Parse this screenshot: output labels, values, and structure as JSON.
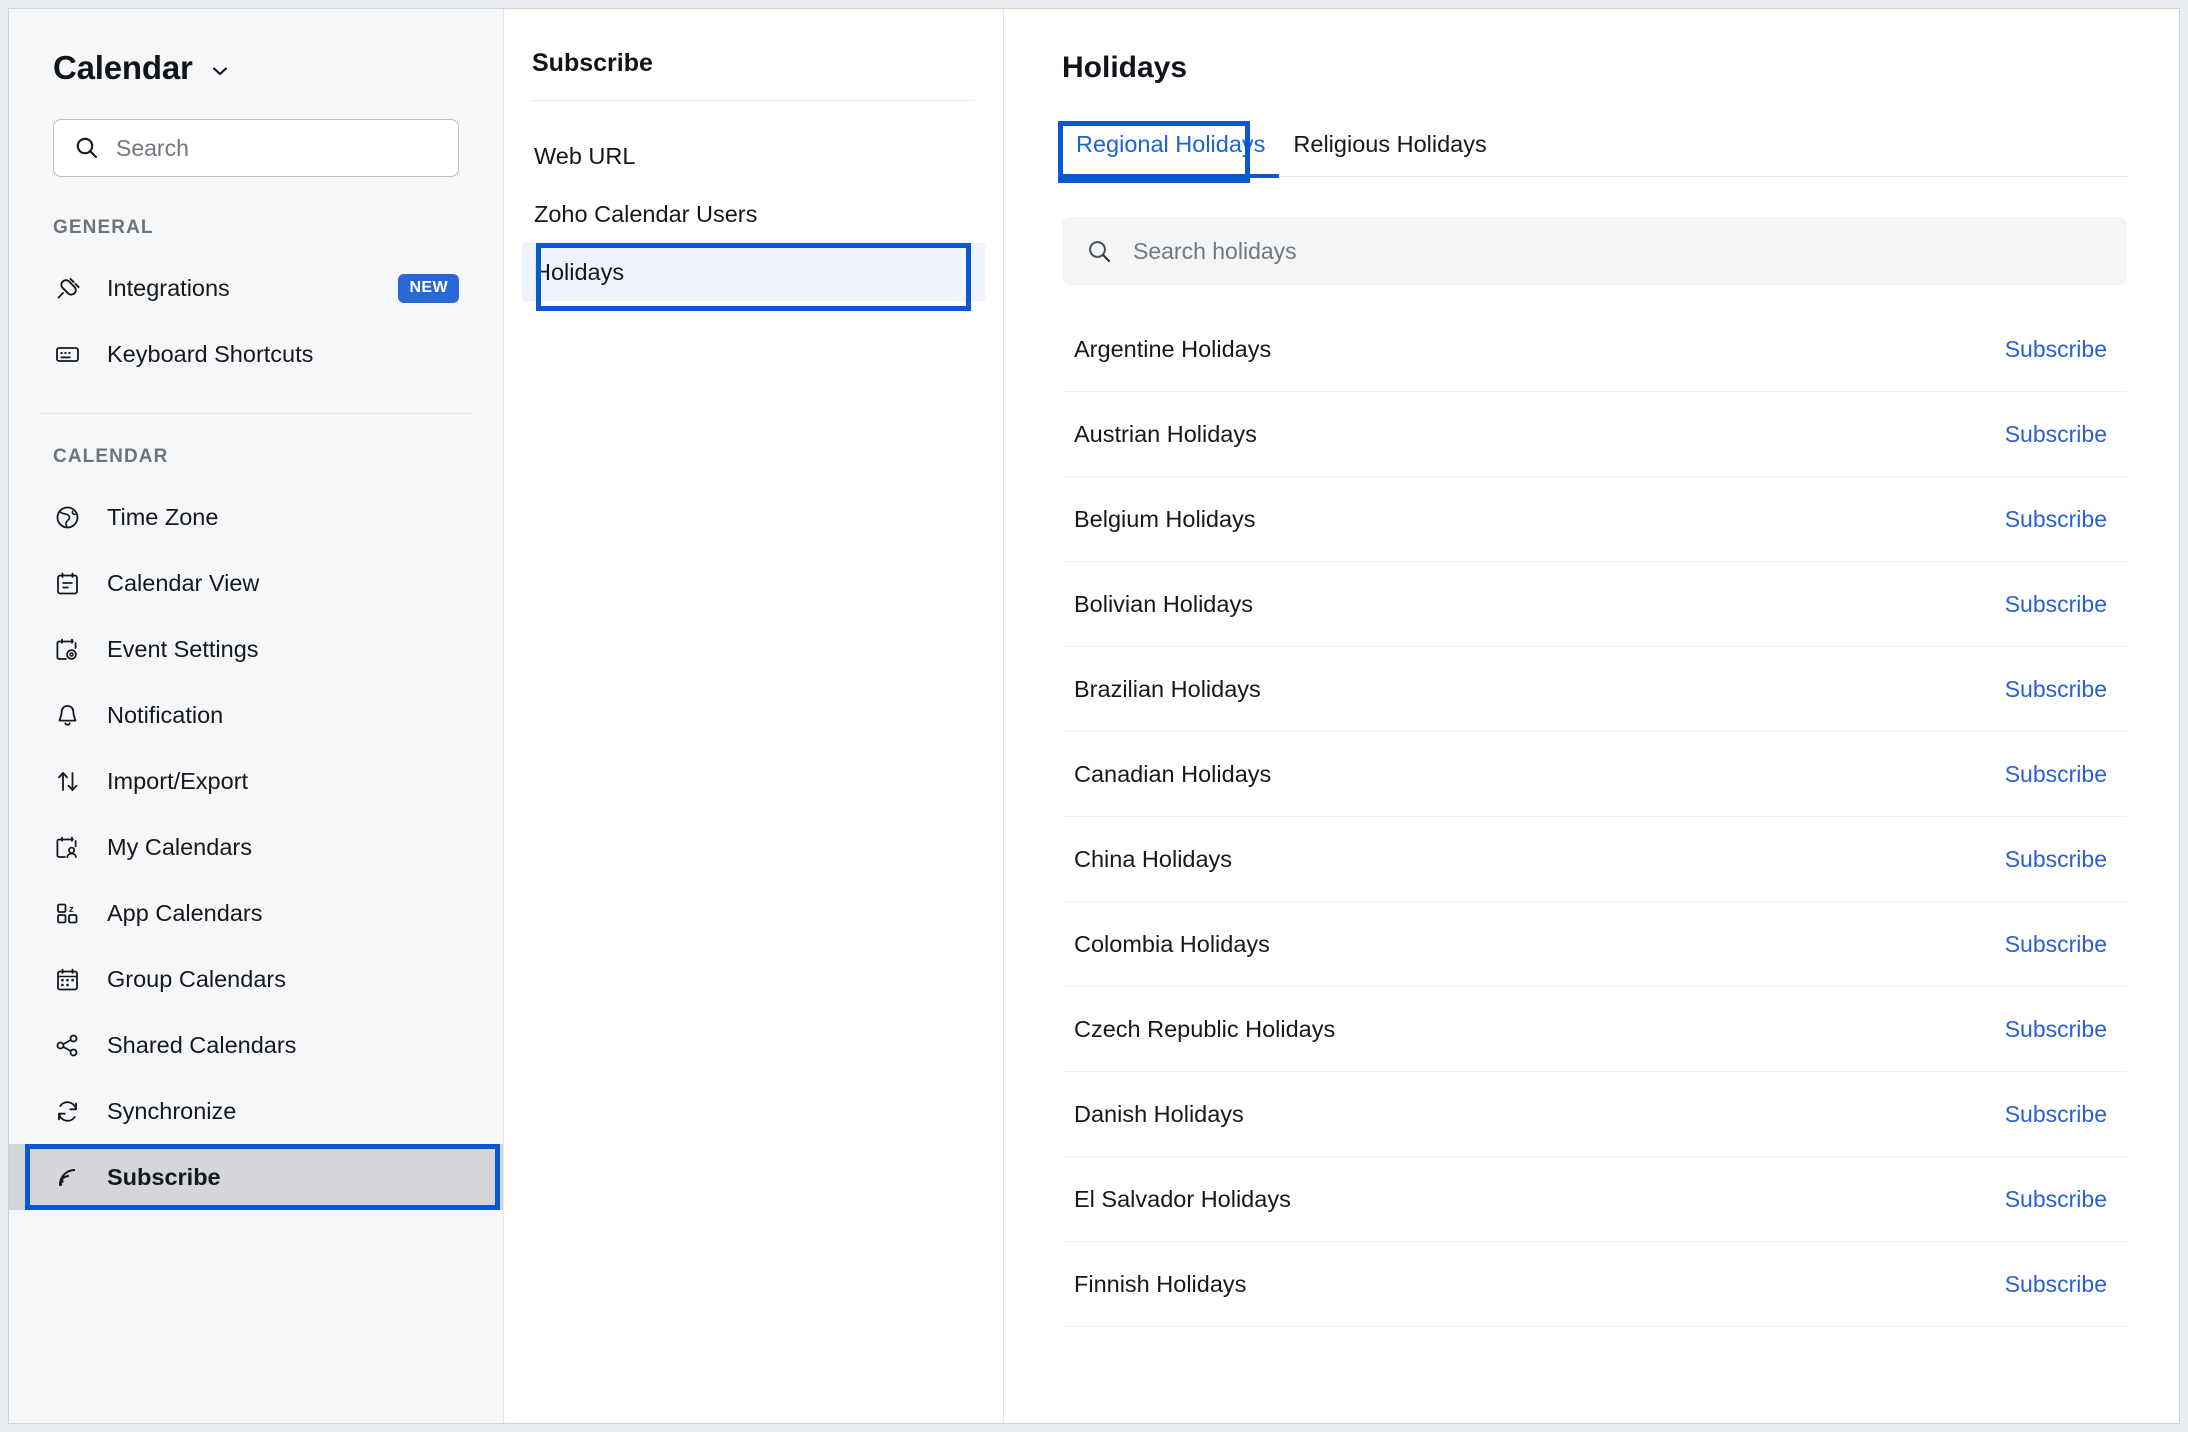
{
  "sidebar": {
    "title": "Calendar",
    "chevron_icon": "chevron-down-icon",
    "search": {
      "placeholder": "Search",
      "value": "",
      "icon": "search-icon"
    },
    "groups": [
      {
        "label": "GENERAL",
        "items": [
          {
            "label": "Integrations",
            "icon": "plug-icon",
            "badge": "NEW"
          },
          {
            "label": "Keyboard Shortcuts",
            "icon": "keyboard-icon"
          }
        ]
      },
      {
        "label": "CALENDAR",
        "items": [
          {
            "label": "Time Zone",
            "icon": "globe-icon"
          },
          {
            "label": "Calendar View",
            "icon": "calendar-lines-icon"
          },
          {
            "label": "Event Settings",
            "icon": "calendar-gear-icon"
          },
          {
            "label": "Notification",
            "icon": "bell-icon"
          },
          {
            "label": "Import/Export",
            "icon": "arrows-up-down-icon"
          },
          {
            "label": "My Calendars",
            "icon": "calendar-person-icon"
          },
          {
            "label": "App Calendars",
            "icon": "apps-grid-icon"
          },
          {
            "label": "Group Calendars",
            "icon": "calendar-grid-icon"
          },
          {
            "label": "Shared Calendars",
            "icon": "share-nodes-icon"
          },
          {
            "label": "Synchronize",
            "icon": "refresh-icon"
          },
          {
            "label": "Subscribe",
            "icon": "rss-icon",
            "selected": true,
            "highlighted": true
          }
        ]
      }
    ]
  },
  "middle": {
    "title": "Subscribe",
    "items": [
      {
        "label": "Web URL"
      },
      {
        "label": "Zoho Calendar Users"
      },
      {
        "label": "Holidays",
        "active": true,
        "highlighted": true
      }
    ]
  },
  "right": {
    "title": "Holidays",
    "tabs": [
      {
        "label": "Regional Holidays",
        "active": true,
        "highlighted": true
      },
      {
        "label": "Religious Holidays",
        "active": false
      }
    ],
    "search": {
      "placeholder": "Search holidays",
      "value": "",
      "icon": "search-icon"
    },
    "subscribe_label": "Subscribe",
    "holidays": [
      "Argentine Holidays",
      "Austrian Holidays",
      "Belgium Holidays",
      "Bolivian Holidays",
      "Brazilian Holidays",
      "Canadian Holidays",
      "China Holidays",
      "Colombia Holidays",
      "Czech Republic Holidays",
      "Danish Holidays",
      "El Salvador Holidays",
      "Finnish Holidays"
    ]
  },
  "colors": {
    "accent_blue": "#0b57d0",
    "link_blue": "#2a5fd4",
    "badge_blue": "#2a68d8",
    "sidebar_bg": "#f6f7f8",
    "selected_row": "#d4d6d9",
    "active_item": "#eef3fc",
    "text": "#15181d",
    "muted": "#6d737c"
  }
}
